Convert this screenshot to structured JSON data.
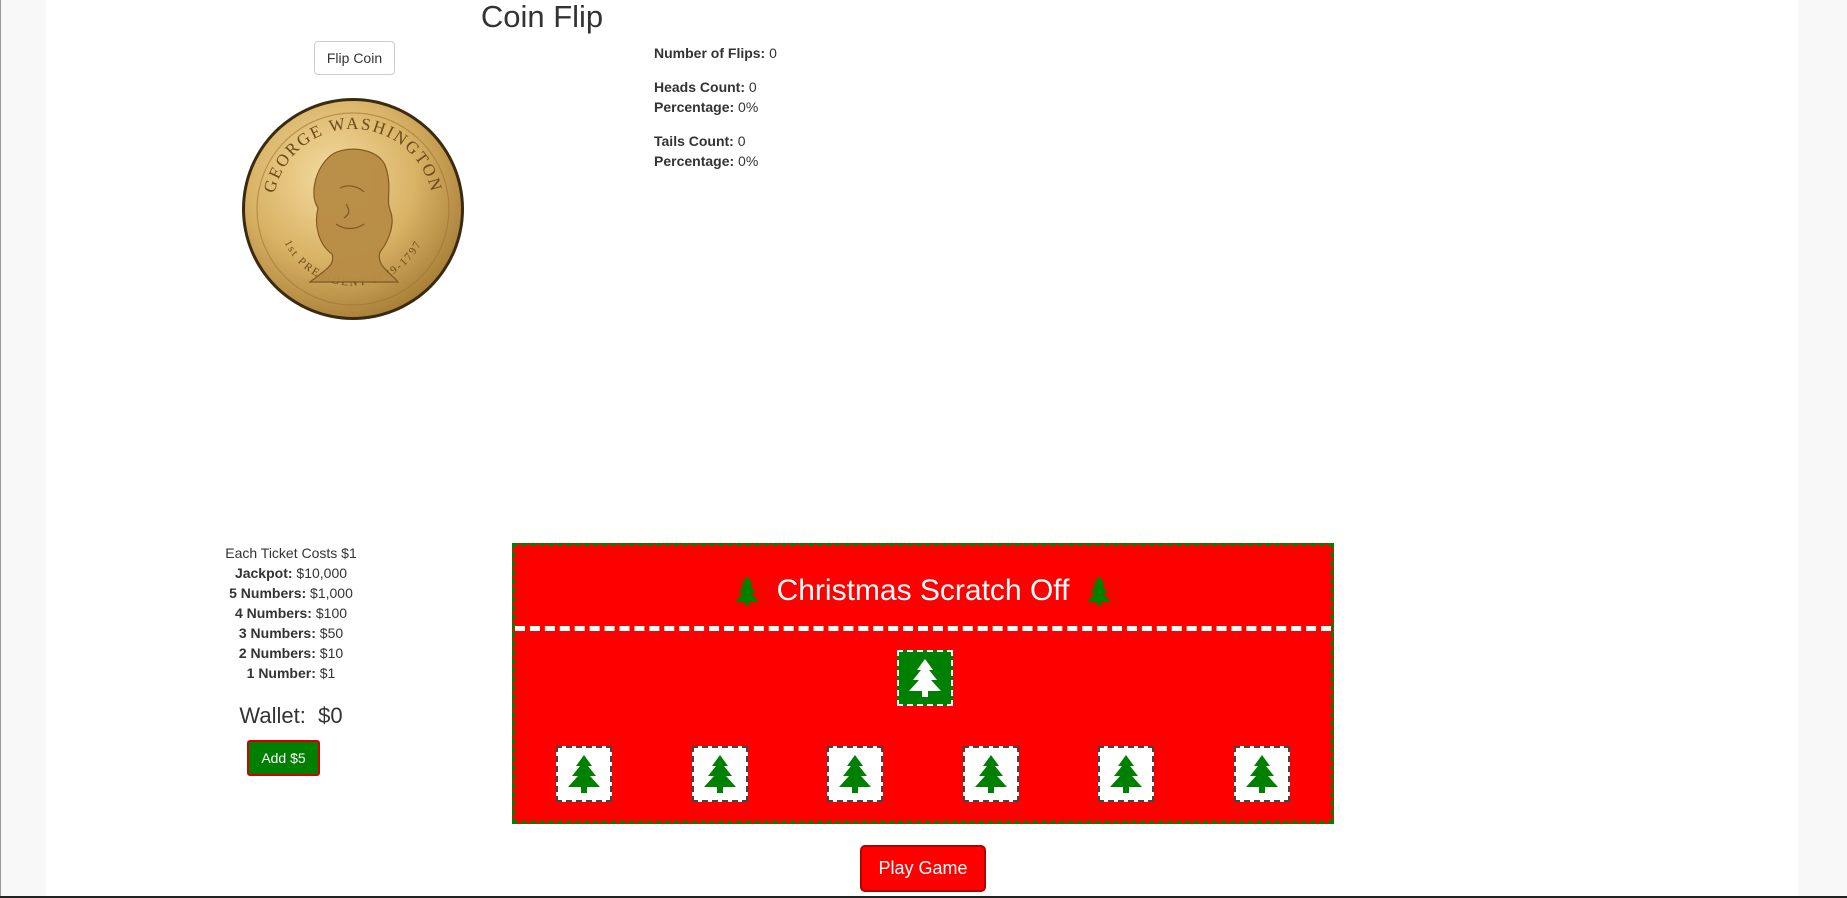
{
  "coin_flip": {
    "title": "Coin Flip",
    "flip_button_label": "Flip Coin",
    "coin": {
      "face": "heads",
      "inscription_top": "GEORGE WASHINGTON",
      "inscription_bottom": "1st PRESIDENT 1789-1797"
    },
    "stats": {
      "flips_label": "Number of Flips:",
      "flips_value": "0",
      "heads_label": "Heads Count:",
      "heads_value": "0",
      "heads_pct_label": "Percentage:",
      "heads_pct_value": "0%",
      "tails_label": "Tails Count:",
      "tails_value": "0",
      "tails_pct_label": "Percentage:",
      "tails_pct_value": "0%"
    }
  },
  "lottery": {
    "ticket_cost": "Each Ticket Costs $1",
    "prizes": [
      {
        "label": "Jackpot:",
        "value": "$10,000"
      },
      {
        "label": "5 Numbers:",
        "value": "$1,000"
      },
      {
        "label": "4 Numbers:",
        "value": "$100"
      },
      {
        "label": "3 Numbers:",
        "value": "$50"
      },
      {
        "label": "2 Numbers:",
        "value": "$10"
      },
      {
        "label": "1 Number:",
        "value": "$1"
      }
    ],
    "wallet_label": "Wallet:",
    "wallet_value": "$0",
    "add_button_label": "Add $5"
  },
  "scratch_card": {
    "title": "Christmas Scratch Off",
    "tile_icon": "christmas-tree-icon",
    "main_tile_count": 1,
    "number_tile_count": 6,
    "colors": {
      "card": "#ff0000",
      "tree": "#008000",
      "border": "#008000"
    },
    "play_button_label": "Play Game"
  }
}
